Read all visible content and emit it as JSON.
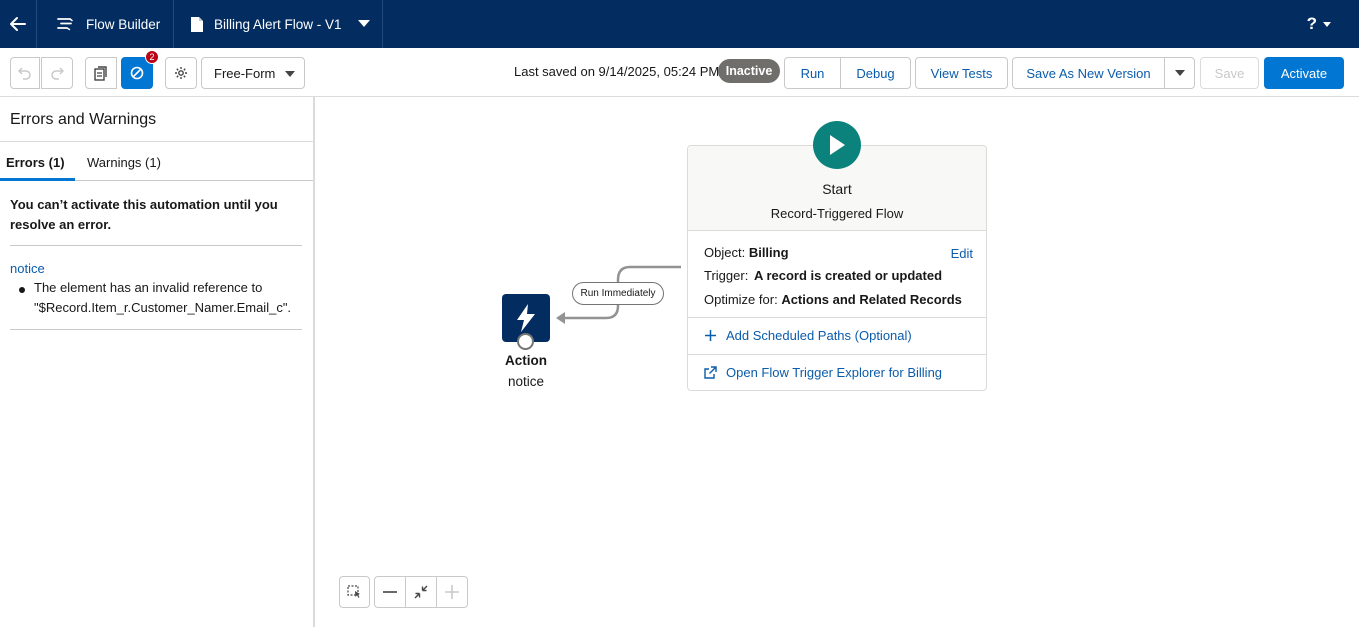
{
  "header": {
    "back_icon": "back-arrow-icon",
    "app_icon": "flow-builder-icon",
    "app_name": "Flow Builder",
    "file_icon": "document-icon",
    "flow_name": "Billing Alert Flow - V1",
    "help_label": "?"
  },
  "toolbar": {
    "error_count": "2",
    "canvas_mode": "Free-Form",
    "last_saved": "Last saved on 9/14/2025, 05:24 PM",
    "status": "Inactive",
    "run_label": "Run",
    "debug_label": "Debug",
    "view_tests_label": "View Tests",
    "save_as_new_version_label": "Save As New Version",
    "save_label": "Save",
    "activate_label": "Activate",
    "accent_color": "#0176d3"
  },
  "panel": {
    "title": "Errors and Warnings",
    "tabs": [
      {
        "label": "Errors (1)",
        "active": true
      },
      {
        "label": "Warnings (1)",
        "active": false
      }
    ],
    "error_heading": "You can’t activate this automation until you resolve an error.",
    "errors": [
      {
        "element": "notice",
        "message": "The element has an invalid reference to \"$Record.Item_r.Customer_Namer.Email_c\"."
      }
    ]
  },
  "canvas": {
    "start": {
      "title": "Start",
      "subtitle": "Record-Triggered Flow",
      "object_label": "Object:",
      "object_value": "Billing",
      "edit_label": "Edit",
      "trigger_label": "Trigger:",
      "trigger_value": "A record is created or updated",
      "optimize_label": "Optimize for:",
      "optimize_value": "Actions and Related Records",
      "add_paths_label": "Add Scheduled Paths (Optional)",
      "explorer_label": "Open Flow Trigger Explorer for Billing",
      "color": "#0b827c"
    },
    "connector_label": "Run Immediately",
    "action": {
      "type": "Action",
      "name": "notice",
      "color": "#032d60"
    }
  }
}
